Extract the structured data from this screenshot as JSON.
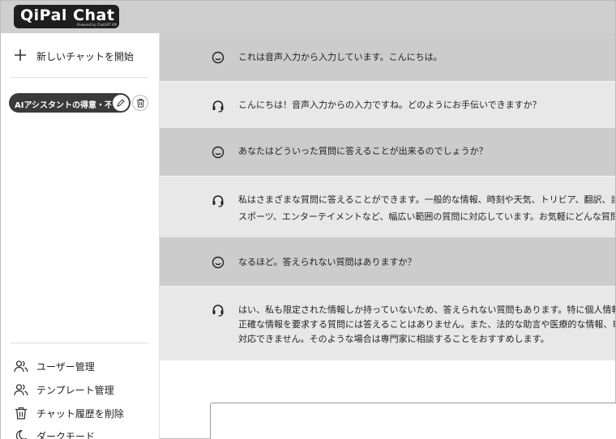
{
  "header": {
    "logo": "QiPal Chat",
    "logo_tagline": "Powered by ChatGPT API"
  },
  "sidebar": {
    "new_chat_label": "新しいチャットを開始",
    "chat_history": [
      {
        "title": "AIアシスタントの得意・不得意"
      }
    ],
    "menu": [
      {
        "label": "ユーザー管理",
        "icon": "users-icon"
      },
      {
        "label": "テンプレート管理",
        "icon": "users-icon"
      },
      {
        "label": "チャット履歴を削除",
        "icon": "trash-icon"
      },
      {
        "label": "ダークモード",
        "icon": "moon-icon"
      }
    ]
  },
  "messages": [
    {
      "role": "user",
      "lines": [
        "これは音声入力から入力しています。こんにちは。"
      ]
    },
    {
      "role": "assistant",
      "lines": [
        "こんにちは！音声入力からの入力ですね。どのようにお手伝いできますか？"
      ]
    },
    {
      "role": "user",
      "lines": [
        "あなたはどういった質問に答えることが出来るのでしょうか？"
      ]
    },
    {
      "role": "assistant",
      "lines": [
        "私はさまざまな質問に答えることができます。一般的な情報、時刻や天気、トリビア、翻訳、計算、",
        "スポーツ、エンターテイメントなど、幅広い範囲の質問に対応しています。お気軽にどんな質問でもどうぞ。"
      ]
    },
    {
      "role": "user",
      "lines": [
        "なるほど。答えられない質問はありますか？"
      ]
    },
    {
      "role": "assistant",
      "lines": [
        "はい、私も限定された情報しか持っていないため、答えられない質問もあります。特に個人情報や",
        "正確な情報を要求する質問には答えることはありません。また、法的な助言や医療的な情報、専門的な質問には",
        "対応できません。そのような場合は専門家に相談することをおすすめします。"
      ]
    }
  ],
  "colors": {
    "topbar": "#cfcfcf",
    "user_row": "#cccccc",
    "assistant_row": "#e8e8e8",
    "chat_item_active": "#3a3a3a"
  }
}
